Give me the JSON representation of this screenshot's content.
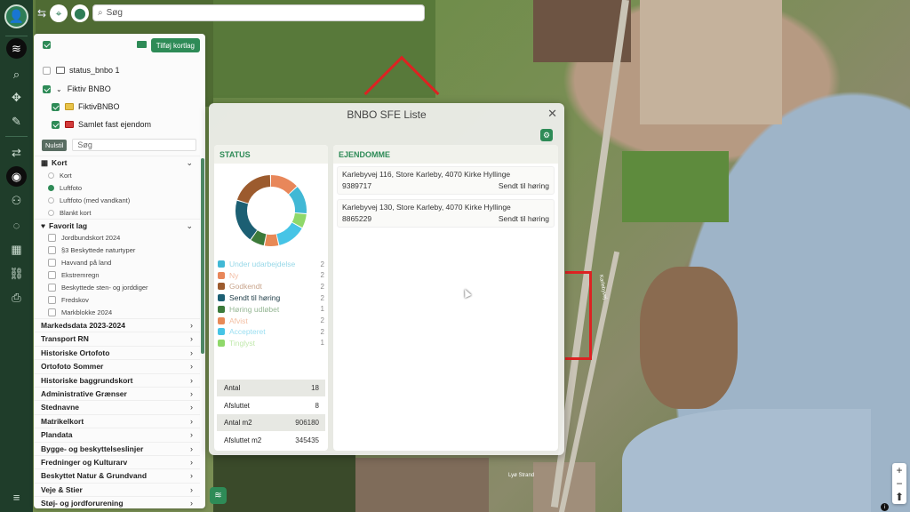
{
  "search": {
    "placeholder": "Søg"
  },
  "layers": {
    "add_button": "Tilføj kortlag",
    "items": [
      {
        "label": "status_bnbo 1",
        "checked": false
      },
      {
        "label": "Fiktiv BNBO",
        "checked": true
      },
      {
        "label": "FiktivBNBO",
        "checked": true
      },
      {
        "label": "Samlet fast ejendom",
        "checked": true
      }
    ],
    "reset": "Nulstil",
    "filter_placeholder": "Søg",
    "kort": {
      "label": "Kort",
      "options": [
        "Kort",
        "Luftfoto",
        "Luftfoto (med vandkant)",
        "Blankt kort"
      ],
      "selected": "Luftfoto"
    },
    "favorit": {
      "label": "Favorit lag",
      "items": [
        "Jordbundskort 2024",
        "§3 Beskyttede naturtyper",
        "Havvand på land",
        "Ekstremregn",
        "Beskyttede sten- og jorddiger",
        "Fredskov",
        "Markblokke 2024"
      ]
    },
    "groups": [
      "Markedsdata 2023-2024",
      "Transport RN",
      "Historiske Ortofoto",
      "Ortofoto Sommer",
      "Historiske baggrundskort",
      "Administrative Grænser",
      "Stednavne",
      "Matrikelkort",
      "Plandata",
      "Bygge- og beskyttelseslinjer",
      "Fredninger og Kulturarv",
      "Beskyttet Natur & Grundvand",
      "Veje & Stier",
      "Støj- og jordforurening"
    ]
  },
  "modal": {
    "title": "BNBO SFE Liste",
    "status_header": "STATUS",
    "ejendomme_header": "EJENDOMME",
    "statuses": [
      {
        "label": "Under udarbejdelse",
        "count": "2",
        "color": "#41b8d5"
      },
      {
        "label": "Ny",
        "count": "2",
        "color": "#e8875a"
      },
      {
        "label": "Godkendt",
        "count": "2",
        "color": "#9c5b2e"
      },
      {
        "label": "Sendt til høring",
        "count": "2",
        "color": "#1c5f73"
      },
      {
        "label": "Høring udløbet",
        "count": "1",
        "color": "#3c7a3a"
      },
      {
        "label": "Afvist",
        "count": "2",
        "color": "#e88956"
      },
      {
        "label": "Accepteret",
        "count": "2",
        "color": "#46c4e6"
      },
      {
        "label": "Tinglyst",
        "count": "1",
        "color": "#8fd86a"
      }
    ],
    "stats": [
      {
        "label": "Antal",
        "value": "18"
      },
      {
        "label": "Afsluttet",
        "value": "8"
      },
      {
        "label": "Antal m2",
        "value": "906180"
      },
      {
        "label": "Afsluttet m2",
        "value": "345435"
      }
    ],
    "ejendomme": [
      {
        "address": "Karlebyvej 116, Store Karleby, 4070 Kirke Hyllinge",
        "number": "9389717",
        "status": "Sendt til høring"
      },
      {
        "address": "Karlebyvej 130, Store Karleby, 4070 Kirke Hyllinge",
        "number": "8865229",
        "status": "Sendt til høring"
      }
    ]
  },
  "chart_data": {
    "type": "pie",
    "categories": [
      "Under udarbejdelse",
      "Ny",
      "Godkendt",
      "Sendt til høring",
      "Høring udløbet",
      "Afvist",
      "Accepteret",
      "Tinglyst"
    ],
    "values": [
      2,
      2,
      2,
      2,
      1,
      2,
      2,
      1
    ],
    "title": "",
    "ring_order": [
      {
        "label": "Ny",
        "value": 2,
        "color": "#e8875a"
      },
      {
        "label": "Under udarbejdelse",
        "value": 2,
        "color": "#41b8d5"
      },
      {
        "label": "Tinglyst",
        "value": 1,
        "color": "#8fd86a"
      },
      {
        "label": "Accepteret",
        "value": 2,
        "color": "#46c4e6"
      },
      {
        "label": "Afvist",
        "value": 1,
        "color": "#e88956"
      },
      {
        "label": "Høring udløbet",
        "value": 1,
        "color": "#3c7a3a"
      },
      {
        "label": "Sendt til høring",
        "value": 3,
        "color": "#1c5f73"
      },
      {
        "label": "Godkendt",
        "value": 3,
        "color": "#9c5b2e"
      }
    ]
  },
  "map_labels": {
    "road": "Karlebyvej",
    "place": "Lyø Strand"
  },
  "map": {
    "zoom_in": "+",
    "zoom_out": "−",
    "info": "i"
  }
}
